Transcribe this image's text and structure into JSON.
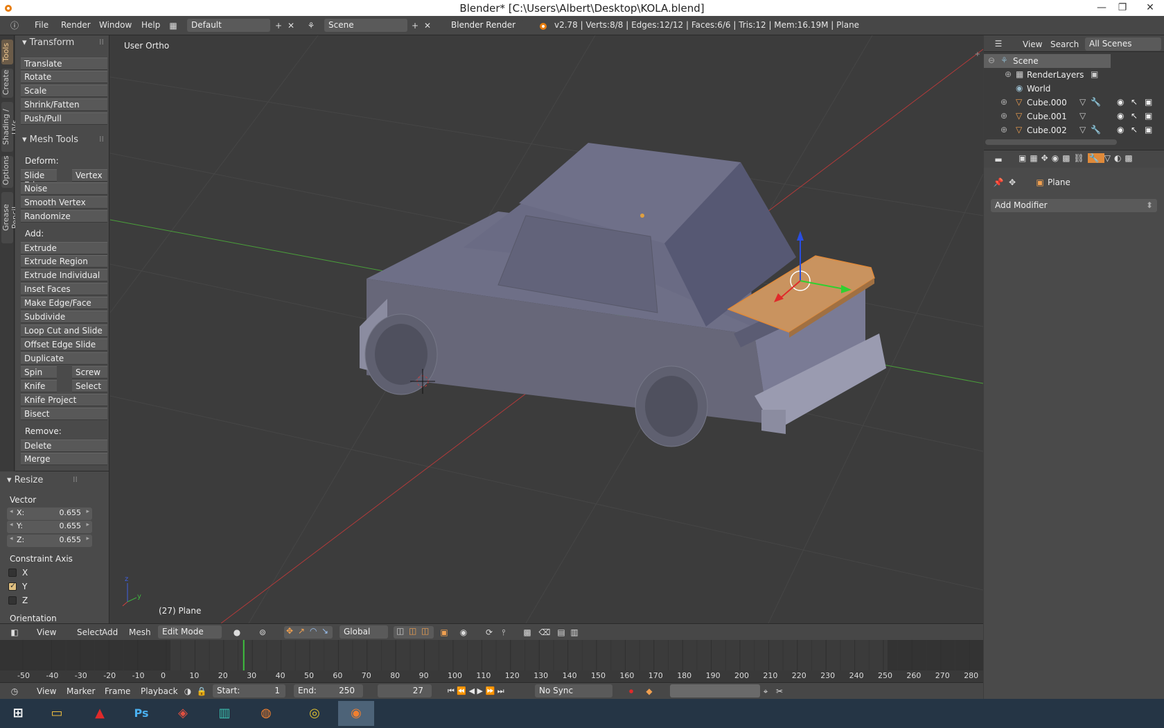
{
  "window": {
    "title": "Blender* [C:\\Users\\Albert\\Desktop\\KOLA.blend]",
    "controls": [
      "—",
      "❐",
      "✕"
    ]
  },
  "info_header": {
    "menus": [
      "File",
      "Render",
      "Window",
      "Help"
    ],
    "layout": "Default",
    "scene": "Scene",
    "engine": "Blender Render",
    "stats": "v2.78 | Verts:8/8 | Edges:12/12 | Faces:6/6 | Tris:12 | Mem:16.19M | Plane"
  },
  "tool_tabs": [
    "Tools",
    "Create",
    "Shading / UVs",
    "Options",
    "Grease Pencil"
  ],
  "tool_shelf": {
    "transform": {
      "title": "Transform",
      "buttons": [
        "Translate",
        "Rotate",
        "Scale",
        "Shrink/Fatten",
        "Push/Pull"
      ]
    },
    "mesh_tools": {
      "title": "Mesh Tools",
      "deform_label": "Deform:",
      "slide_edge": "Slide Ed",
      "vertex": "Vertex",
      "noise": "Noise",
      "smooth_vertex": "Smooth Vertex",
      "randomize": "Randomize",
      "add_label": "Add:",
      "extrude": "Extrude",
      "extrude_region": "Extrude Region",
      "extrude_individual": "Extrude Individual",
      "inset_faces": "Inset Faces",
      "make_edge_face": "Make Edge/Face",
      "subdivide": "Subdivide",
      "loop_cut": "Loop Cut and Slide",
      "offset_edge": "Offset Edge Slide",
      "duplicate": "Duplicate",
      "spin": "Spin",
      "screw": "Screw",
      "knife": "Knife",
      "select": "Select",
      "knife_project": "Knife Project",
      "bisect": "Bisect",
      "remove_label": "Remove:",
      "delete": "Delete",
      "merge": "Merge"
    },
    "resize": {
      "title": "Resize",
      "vector_label": "Vector",
      "x_label": "X:",
      "x": "0.655",
      "y_label": "Y:",
      "y": "0.655",
      "z_label": "Z:",
      "z": "0.655",
      "constraint_label": "Constraint Axis",
      "cx": "X",
      "cy": "Y",
      "cz": "Z",
      "constraint_y_checked": true,
      "orientation_label": "Orientation"
    }
  },
  "viewport": {
    "view_label": "User Ortho",
    "object_label": "(27) Plane"
  },
  "view3d_header": {
    "menus": [
      "View",
      "Select",
      "Add",
      "Mesh"
    ],
    "mode": "Edit Mode",
    "orientation": "Global"
  },
  "timeline": {
    "ticks": [
      "-50",
      "-40",
      "-30",
      "-20",
      "-10",
      "0",
      "10",
      "20",
      "30",
      "40",
      "50",
      "60",
      "70",
      "80",
      "90",
      "100",
      "110",
      "120",
      "130",
      "140",
      "150",
      "160",
      "170",
      "180",
      "190",
      "200",
      "210",
      "220",
      "230",
      "240",
      "250",
      "260",
      "270",
      "280"
    ],
    "current_frame": 27,
    "menus": [
      "View",
      "Marker",
      "Frame",
      "Playback"
    ],
    "start_label": "Start:",
    "start": "1",
    "end_label": "End:",
    "end": "250",
    "frame": "27",
    "sync": "No Sync"
  },
  "outliner": {
    "menus": [
      "View",
      "Search"
    ],
    "filter": "All Scenes",
    "items": [
      "Scene",
      "RenderLayers",
      "World",
      "Cube.000",
      "Cube.001",
      "Cube.002"
    ]
  },
  "properties": {
    "context_object": "Plane",
    "add_modifier": "Add Modifier"
  },
  "taskbar": {
    "apps": [
      "windows-start",
      "file-explorer",
      "acrobat",
      "photoshop",
      "sketchup",
      "maya",
      "firefox",
      "chrome",
      "blender"
    ],
    "ps_label": "Ps"
  },
  "colors": {
    "accent_orange": "#e08a3a",
    "selected_face": "#c9935f",
    "axis_x": "#b33a3a",
    "axis_y": "#4aa03a",
    "frame_cursor": "#3ec03e"
  }
}
